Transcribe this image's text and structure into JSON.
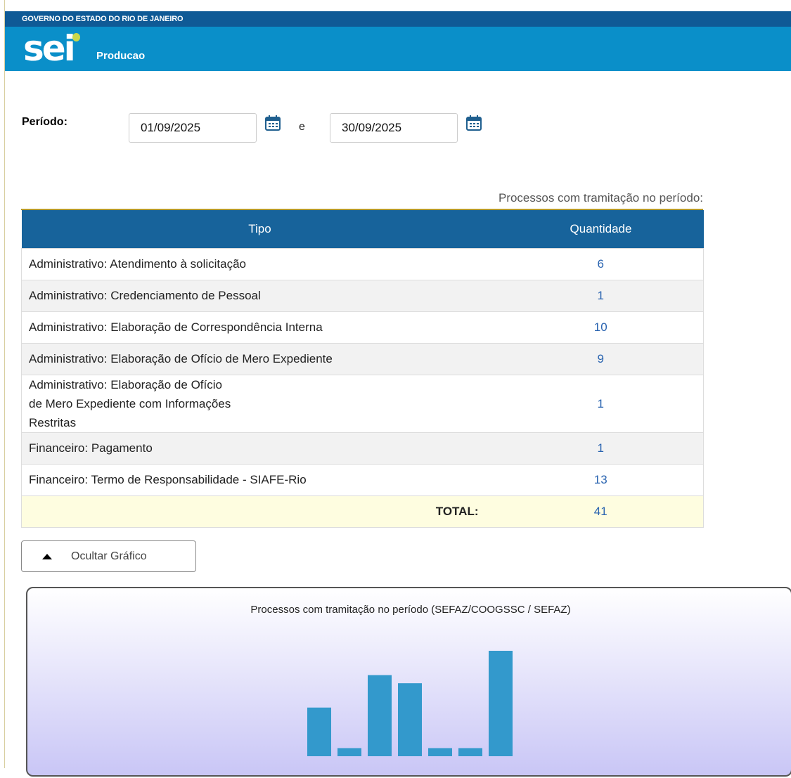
{
  "header": {
    "government": "GOVERNO DO ESTADO DO RIO DE JANEIRO",
    "logo_text": "sei",
    "app_name": "Producao"
  },
  "period": {
    "label": "Período:",
    "start_date": "01/09/2025",
    "separator": "e",
    "end_date": "30/09/2025",
    "icon": "calendar-icon"
  },
  "table": {
    "caption": "Processos com tramitação no período:",
    "columns": [
      "Tipo",
      "Quantidade"
    ],
    "rows": [
      {
        "tipo": "Administrativo: Atendimento à solicitação",
        "quantidade": "6"
      },
      {
        "tipo": "Administrativo: Credenciamento de Pessoal",
        "quantidade": "1"
      },
      {
        "tipo": "Administrativo: Elaboração de Correspondência Interna",
        "quantidade": "10"
      },
      {
        "tipo": "Administrativo: Elaboração de Ofício de Mero Expediente",
        "quantidade": "9"
      },
      {
        "tipo": "Administrativo: Elaboração de Ofício de Mero Expediente com Informações Restritas",
        "quantidade": "1"
      },
      {
        "tipo": "Financeiro: Pagamento",
        "quantidade": "1"
      },
      {
        "tipo": "Financeiro: Termo de Responsabilidade - SIAFE-Rio",
        "quantidade": "13"
      }
    ],
    "total_label": "TOTAL:",
    "total_value": "41"
  },
  "toggle": {
    "label": "Ocultar Gráfico",
    "icon": "triangle-up-icon"
  },
  "colors": {
    "gov_bar": "#0f5a96",
    "app_bar": "#0a8fc9",
    "table_header": "#17639b",
    "link": "#2a64b0",
    "bar": "#3399cc"
  },
  "chart_data": {
    "type": "bar",
    "title": "Processos com tramitação no período (SEFAZ/COOGSSC / SEFAZ)",
    "categories": [
      "Administrativo: Atendimento à solicitação",
      "Administrativo: Credenciamento de Pessoal",
      "Administrativo: Elaboração de Correspondência Interna",
      "Administrativo: Elaboração de Ofício de Mero Expediente",
      "Administrativo: Elaboração de Ofício de Mero Expediente com Informações Restritas",
      "Financeiro: Pagamento",
      "Financeiro: Termo de Responsabilidade - SIAFE-Rio"
    ],
    "values": [
      6,
      1,
      10,
      9,
      1,
      1,
      13
    ]
  }
}
